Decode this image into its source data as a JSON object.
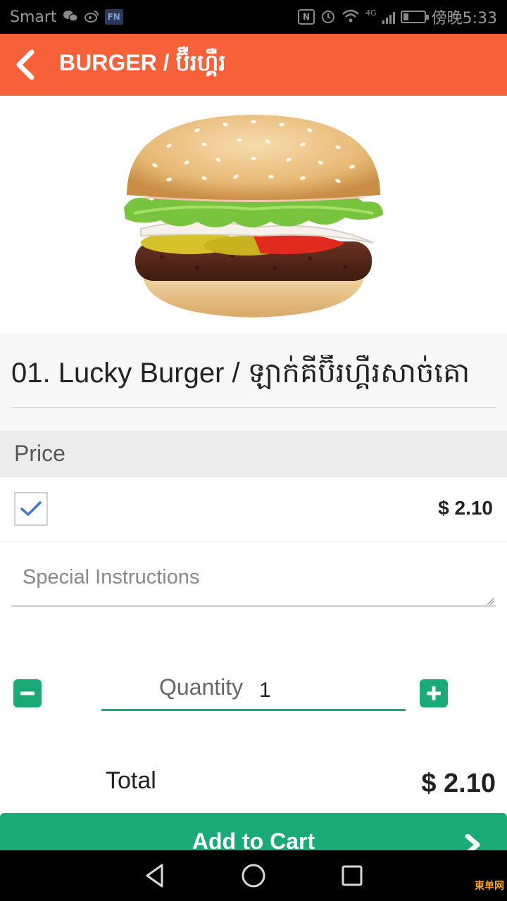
{
  "status_bar": {
    "carrier": "Smart",
    "time": "傍晚5:33",
    "network_type": "4G",
    "icons": [
      "wechat-icon",
      "weibo-icon",
      "fn-app-icon",
      "nfc-icon",
      "alarm-icon",
      "wifi-icon",
      "signal-icon",
      "battery-icon"
    ],
    "fn_badge": "FN",
    "nfc_badge": "N",
    "battery_level": 0.25
  },
  "app_bar": {
    "title": "BURGER / ប៊ឺរហ្គឺរ",
    "back_icon": "chevron-left-icon",
    "color": "#f6613a"
  },
  "item": {
    "title": "01. Lucky Burger / ឡាក់គីប៊ឺរហ្គឺរសាច់គោ",
    "image": "burger-photo"
  },
  "price_section": {
    "header": "Price",
    "options": [
      {
        "checked": true,
        "price": "$ 2.10"
      }
    ]
  },
  "instructions": {
    "placeholder": "Special Instructions",
    "value": ""
  },
  "quantity": {
    "label": "Quantity",
    "value": "1",
    "minus_icon": "minus-icon",
    "plus_icon": "plus-icon",
    "color": "#1aaa78"
  },
  "total": {
    "label": "Total",
    "value": "$ 2.10"
  },
  "add_to_cart": {
    "label": "Add to Cart",
    "icon": "chevron-right-icon",
    "color": "#1aaa78"
  },
  "nav_bar": {
    "buttons": [
      "back-triangle-icon",
      "home-circle-icon",
      "recents-square-icon"
    ]
  },
  "watermark": "東单网"
}
